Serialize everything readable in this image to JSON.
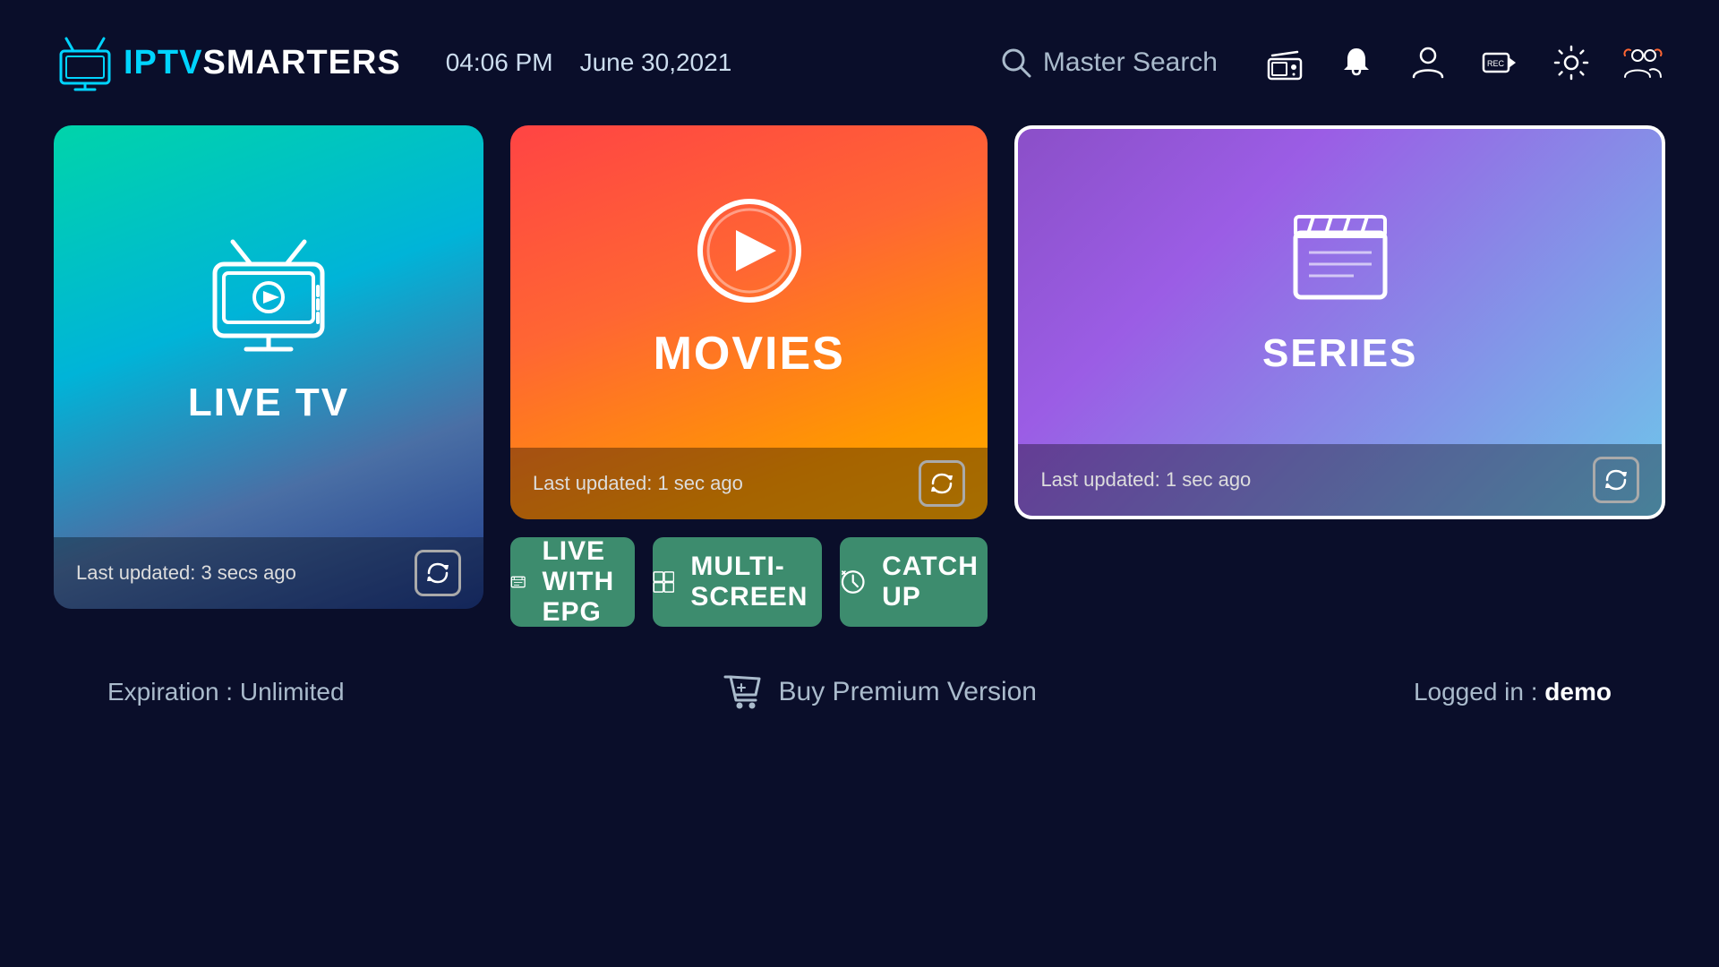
{
  "header": {
    "logo_iptv": "IPTV",
    "logo_smarters": "SMARTERS",
    "time": "04:06 PM",
    "date": "June 30,2021",
    "search_placeholder": "Master Search"
  },
  "cards": {
    "live_tv": {
      "title": "LIVE TV",
      "last_updated": "Last updated: 3 secs ago"
    },
    "movies": {
      "title": "MOVIES",
      "last_updated": "Last updated: 1 sec ago"
    },
    "series": {
      "title": "SERIES",
      "last_updated": "Last updated: 1 sec ago"
    }
  },
  "buttons": {
    "epg": "LIVE WITH EPG",
    "multiscreen": "MULTI-SCREEN",
    "catchup": "CATCH UP"
  },
  "footer": {
    "expiration": "Expiration : Unlimited",
    "buy_premium": "Buy Premium Version",
    "logged_in_label": "Logged in : ",
    "logged_in_user": "demo"
  }
}
